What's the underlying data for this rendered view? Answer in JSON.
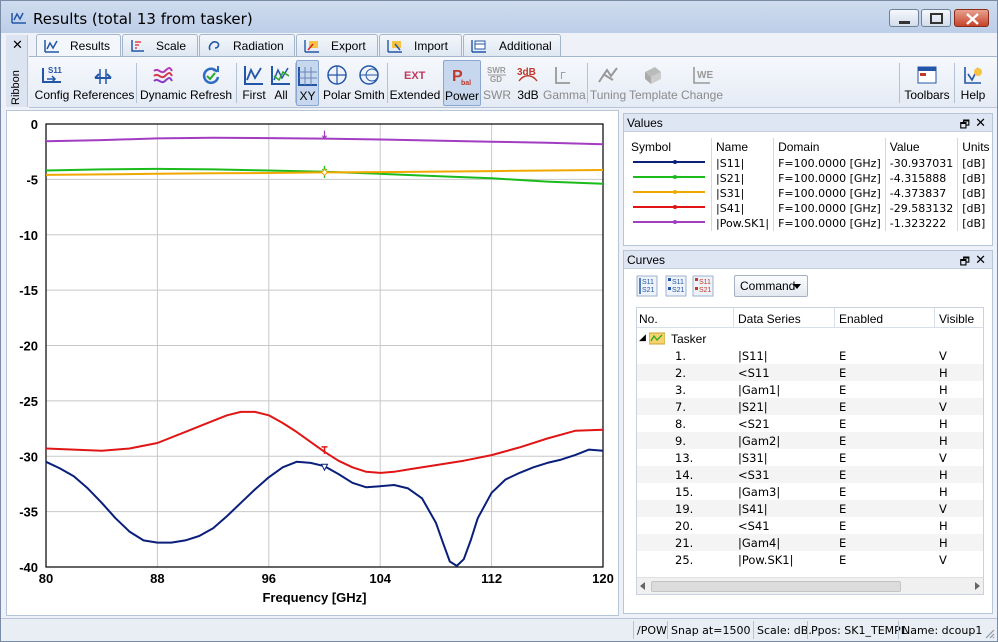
{
  "window": {
    "title": "Results (total 13 from tasker)"
  },
  "ribbon": {
    "label": "Ribbon",
    "close": "✕"
  },
  "tabs": [
    {
      "label": "Results",
      "icon": "results-tab-icon",
      "active": true
    },
    {
      "label": "Scale",
      "icon": "scale-tab-icon"
    },
    {
      "label": "Radiation",
      "icon": "radiation-tab-icon"
    },
    {
      "label": "Export",
      "icon": "export-tab-icon"
    },
    {
      "label": "Import",
      "icon": "import-tab-icon"
    },
    {
      "label": "Additional",
      "icon": "additional-tab-icon"
    }
  ],
  "toolbar": {
    "config": "Config",
    "references": "References",
    "dynamic": "Dynamic",
    "refresh": "Refresh",
    "first": "First",
    "all": "All",
    "xy": "XY",
    "polar": "Polar",
    "smith": "Smith",
    "extended": "Extended",
    "power": "Power",
    "swr": "SWR",
    "db3": "3dB",
    "gamma": "Gamma",
    "tuning": "Tuning",
    "template": "Template",
    "change": "Change",
    "toolbars": "Toolbars",
    "help": "Help",
    "icon_text": {
      "s11": "S11",
      "ext": "EXT",
      "pbal": "P",
      "pbal_sub": "bal",
      "swr_gd": "SWR",
      "gd": "GD",
      "db3": "3dB",
      "gk": "Γ",
      "we": "WE"
    }
  },
  "chart_data": {
    "type": "line",
    "xlabel": "Frequency [GHz]",
    "ylabel": "",
    "xlim": [
      80,
      120
    ],
    "ylim": [
      -40,
      0
    ],
    "x_ticks": [
      "80",
      "88",
      "96",
      "104",
      "112",
      "120"
    ],
    "y_ticks": [
      "0",
      "-5",
      "-10",
      "-15",
      "-20",
      "-25",
      "-30",
      "-35",
      "-40"
    ],
    "grid": true,
    "marker_x": 100,
    "series": [
      {
        "name": "|S11|",
        "color": "#0a1f7a",
        "marker": "triangle-down",
        "x": [
          80,
          81,
          82,
          83,
          84,
          85,
          86,
          87,
          88,
          89,
          90,
          91,
          92,
          93,
          94,
          95,
          96,
          97,
          98,
          99,
          100,
          101,
          102,
          103,
          104,
          105,
          106,
          107,
          108,
          108.5,
          109,
          109.5,
          110,
          110.5,
          111,
          112,
          113,
          114,
          115,
          116,
          117,
          118,
          119,
          120
        ],
        "y": [
          -30.5,
          -31.1,
          -31.8,
          -32.9,
          -34.2,
          -35.6,
          -36.8,
          -37.6,
          -37.8,
          -37.8,
          -37.6,
          -37.2,
          -36.5,
          -35.4,
          -34.2,
          -33.0,
          -31.9,
          -31.0,
          -30.5,
          -30.6,
          -30.9,
          -31.6,
          -32.4,
          -32.8,
          -32.7,
          -32.6,
          -32.9,
          -33.8,
          -36.0,
          -37.8,
          -39.5,
          -39.9,
          -39.3,
          -37.6,
          -35.6,
          -33.3,
          -32.1,
          -31.5,
          -31.0,
          -30.6,
          -30.3,
          -29.9,
          -29.4,
          -29.5
        ]
      },
      {
        "name": "|S21|",
        "color": "#1bbb1b",
        "marker": "bar",
        "x": [
          80,
          84,
          88,
          92,
          96,
          100,
          104,
          108,
          112,
          116,
          120
        ],
        "y": [
          -4.2,
          -4.1,
          -4.05,
          -4.1,
          -4.2,
          -4.32,
          -4.5,
          -4.7,
          -4.9,
          -5.2,
          -5.4
        ]
      },
      {
        "name": "|S31|",
        "color": "#f0a800",
        "marker": "diamond",
        "x": [
          80,
          84,
          88,
          92,
          96,
          100,
          104,
          108,
          112,
          116,
          120
        ],
        "y": [
          -4.6,
          -4.55,
          -4.5,
          -4.45,
          -4.42,
          -4.37,
          -4.34,
          -4.3,
          -4.25,
          -4.2,
          -4.15
        ]
      },
      {
        "name": "|S41|",
        "color": "#e01515",
        "marker": "T",
        "x": [
          80,
          82,
          84,
          86,
          88,
          90,
          92,
          93,
          94,
          95,
          96,
          97,
          98,
          99,
          100,
          101,
          102,
          103,
          104,
          105,
          106,
          108,
          110,
          112,
          114,
          116,
          118,
          120
        ],
        "y": [
          -29.3,
          -29.4,
          -29.5,
          -29.3,
          -28.8,
          -27.8,
          -26.8,
          -26.3,
          -26.0,
          -26.0,
          -26.3,
          -27.0,
          -27.8,
          -28.7,
          -29.6,
          -30.4,
          -31.0,
          -31.4,
          -31.5,
          -31.4,
          -31.2,
          -30.8,
          -30.4,
          -29.9,
          -29.2,
          -28.4,
          -27.7,
          -27.6
        ]
      },
      {
        "name": "|Pow.SK1|",
        "color": "#a23cc2",
        "marker": "arrow-down",
        "x": [
          80,
          84,
          88,
          92,
          96,
          100,
          104,
          108,
          112,
          116,
          120
        ],
        "y": [
          -1.55,
          -1.45,
          -1.3,
          -1.25,
          -1.27,
          -1.32,
          -1.4,
          -1.5,
          -1.6,
          -1.7,
          -1.82
        ]
      }
    ]
  },
  "values_panel": {
    "title": "Values",
    "columns": [
      "Symbol",
      "Name",
      "Domain",
      "Value",
      "Units"
    ],
    "rows": [
      {
        "name": "|S11|",
        "domain": "F=100.0000 [GHz]",
        "value": "-30.937031",
        "units": "[dB]",
        "color": "#0a1f7a"
      },
      {
        "name": "|S21|",
        "domain": "F=100.0000 [GHz]",
        "value": "-4.315888",
        "units": "[dB]",
        "color": "#1bbb1b"
      },
      {
        "name": "|S31|",
        "domain": "F=100.0000 [GHz]",
        "value": "-4.373837",
        "units": "[dB]",
        "color": "#f0a800"
      },
      {
        "name": "|S41|",
        "domain": "F=100.0000 [GHz]",
        "value": "-29.583132",
        "units": "[dB]",
        "color": "#e01515"
      },
      {
        "name": "|Pow.SK1|",
        "domain": "F=100.0000 [GHz]",
        "value": "-1.323222",
        "units": "[dB]",
        "color": "#a23cc2"
      }
    ]
  },
  "curves_panel": {
    "title": "Curves",
    "command_label": "Command",
    "columns": [
      "No.",
      "Data Series",
      "Enabled",
      "Visible"
    ],
    "group_label": "Tasker",
    "icon_text": {
      "s11": "S11",
      "s21": "S21"
    },
    "rows": [
      {
        "no": "1.",
        "series": "|S11|",
        "enabled": "E",
        "visible": "V"
      },
      {
        "no": "2.",
        "series": "<S11",
        "enabled": "E",
        "visible": "H"
      },
      {
        "no": "3.",
        "series": "|Gam1|",
        "enabled": "E",
        "visible": "H"
      },
      {
        "no": "7.",
        "series": "|S21|",
        "enabled": "E",
        "visible": "V"
      },
      {
        "no": "8.",
        "series": "<S21",
        "enabled": "E",
        "visible": "H"
      },
      {
        "no": "9.",
        "series": "|Gam2|",
        "enabled": "E",
        "visible": "H"
      },
      {
        "no": "13.",
        "series": "|S31|",
        "enabled": "E",
        "visible": "V"
      },
      {
        "no": "14.",
        "series": "<S31",
        "enabled": "E",
        "visible": "H"
      },
      {
        "no": "15.",
        "series": "|Gam3|",
        "enabled": "E",
        "visible": "H"
      },
      {
        "no": "19.",
        "series": "|S41|",
        "enabled": "E",
        "visible": "V"
      },
      {
        "no": "20.",
        "series": "<S41",
        "enabled": "E",
        "visible": "H"
      },
      {
        "no": "21.",
        "series": "|Gam4|",
        "enabled": "E",
        "visible": "H"
      },
      {
        "no": "25.",
        "series": "|Pow.SK1|",
        "enabled": "E",
        "visible": "V"
      }
    ]
  },
  "statusbar": {
    "mode": "/POW",
    "snap": "Snap at=1500",
    "scale": "Scale: dB.",
    "ppos": "Ppos: SK1_TEMPL",
    "name": "Name: dcoup1"
  },
  "panel_controls": {
    "float": "🗗",
    "close": "✕"
  }
}
